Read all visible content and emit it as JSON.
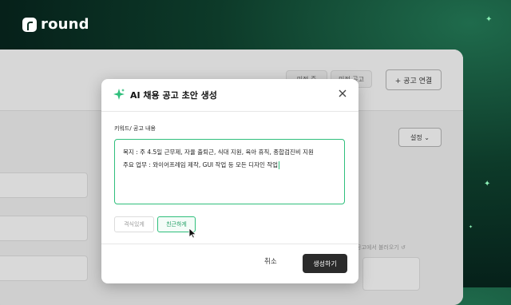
{
  "brand": {
    "name": "round"
  },
  "background_app": {
    "tab_left": "미정 중",
    "tab_right": "미정 공고",
    "add_button": "+ 공고 연결",
    "settings_button": "설정",
    "hint_text": "공고에서 불러오기"
  },
  "modal": {
    "title": "AI 채용 공고 초안 생성",
    "field_label": "키워드/ 공고 내용",
    "textarea_value": "복지 : 주 4.5일 근무제, 자율 출퇴근, 식대 지원, 육아 휴직, 종합검진비 지원\n주요 업무 : 와이어프레임 제작, GUI 작업 등 모든 디자인 작업",
    "tones": [
      {
        "label": "격식있게",
        "selected": false
      },
      {
        "label": "친근하게",
        "selected": true
      }
    ],
    "cancel_label": "취소",
    "submit_label": "생성하기"
  },
  "colors": {
    "accent": "#2fbf7c",
    "submit_bg": "#2b2b2b",
    "page_bg": "#06211a"
  }
}
